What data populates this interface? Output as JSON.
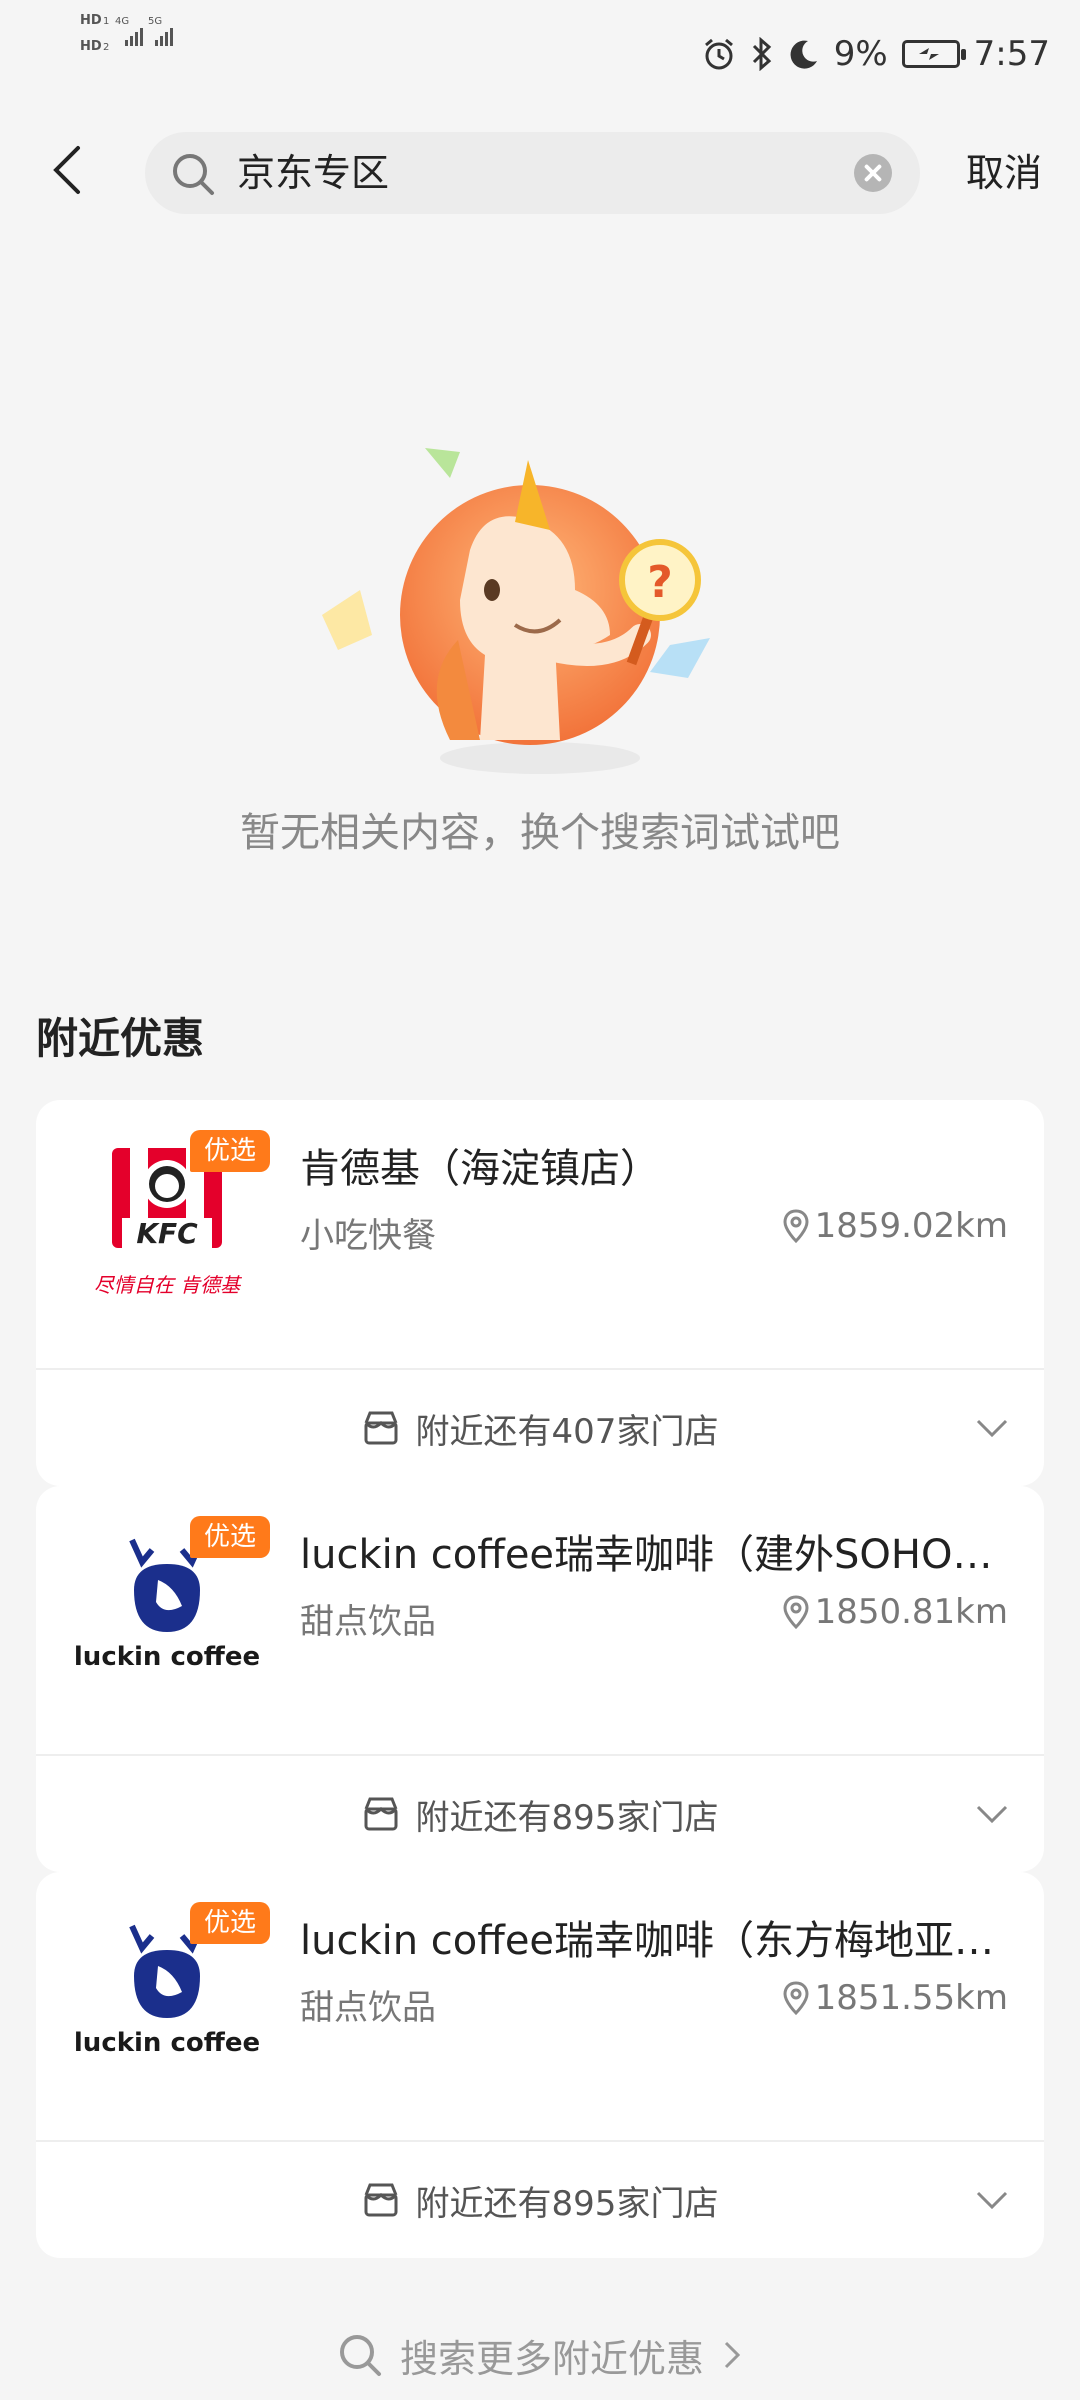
{
  "status_bar": {
    "sim1": "HD",
    "sim1_index": "1",
    "sim2": "HD",
    "sim2_index": "2",
    "net1": "4G",
    "net2": "5G",
    "battery": "9%",
    "time": "7:57",
    "icons": [
      "alarm-icon",
      "bluetooth-icon",
      "moon-icon",
      "battery-icon"
    ]
  },
  "search": {
    "value": "京东专区",
    "cancel_label": "取消"
  },
  "empty_state": {
    "message": "暂无相关内容，换个搜索词试试吧"
  },
  "nearby": {
    "title": "附近优惠",
    "stores": [
      {
        "badge": "优选",
        "name": "肯德基（海淀镇店）",
        "category": "小吃快餐",
        "distance": "1859.02km",
        "more": "附近还有407家门店",
        "logo_text": "KFC",
        "logo_tagline": "尽情自在 肯德基"
      },
      {
        "badge": "优选",
        "name": "luckin coffee瑞幸咖啡（建外SOHO…",
        "category": "甜点饮品",
        "distance": "1850.81km",
        "more": "附近还有895家门店",
        "logo_text": "luckin coffee"
      },
      {
        "badge": "优选",
        "name": "luckin coffee瑞幸咖啡（东方梅地亚…",
        "category": "甜点饮品",
        "distance": "1851.55km",
        "more": "附近还有895家门店",
        "logo_text": "luckin coffee"
      }
    ]
  },
  "search_more": {
    "label": "搜索更多附近优惠"
  },
  "colors": {
    "badge": "#ff7a1a",
    "kfc_red": "#e4002b",
    "luckin_blue": "#1b2f8c",
    "background": "#f5f5f5"
  }
}
